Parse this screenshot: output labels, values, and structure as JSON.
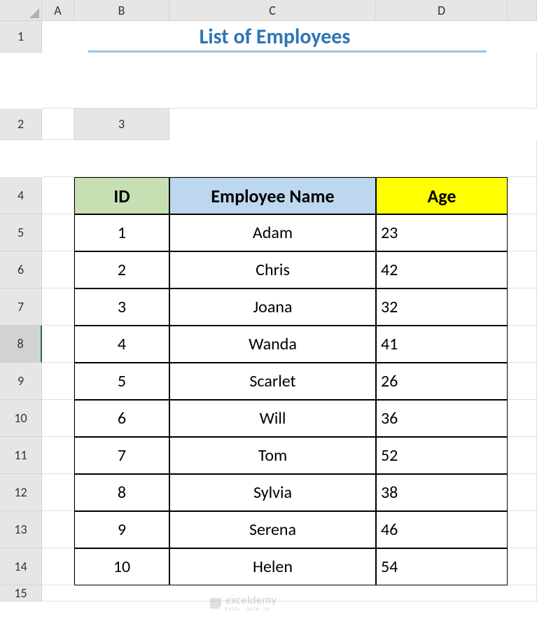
{
  "columns": [
    "A",
    "B",
    "C",
    "D"
  ],
  "rows": [
    "1",
    "2",
    "3",
    "4",
    "5",
    "6",
    "7",
    "8",
    "9",
    "10",
    "11",
    "12",
    "13",
    "14",
    "15"
  ],
  "selectedRow": "8",
  "title": "List of Employees",
  "table": {
    "headers": {
      "id": "ID",
      "name": "Employee Name",
      "age": "Age"
    },
    "rows": [
      {
        "id": "1",
        "name": "Adam",
        "age": "23"
      },
      {
        "id": "2",
        "name": "Chris",
        "age": "42"
      },
      {
        "id": "3",
        "name": "Joana",
        "age": "32"
      },
      {
        "id": "4",
        "name": "Wanda",
        "age": "41"
      },
      {
        "id": "5",
        "name": "Scarlet",
        "age": "26"
      },
      {
        "id": "6",
        "name": "Will",
        "age": "36"
      },
      {
        "id": "7",
        "name": "Tom",
        "age": "52"
      },
      {
        "id": "8",
        "name": "Sylvia",
        "age": "38"
      },
      {
        "id": "9",
        "name": "Serena",
        "age": "46"
      },
      {
        "id": "10",
        "name": "Helen",
        "age": "54"
      }
    ]
  },
  "watermark": {
    "brand": "exceldemy",
    "tagline": "EXCEL · DATA · BI"
  }
}
